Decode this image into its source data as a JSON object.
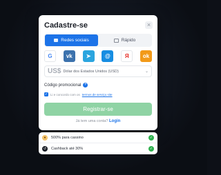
{
  "modal": {
    "title": "Cadastre-se",
    "close_glyph": "×"
  },
  "tabs": [
    {
      "label": "Redes sociais",
      "active": true,
      "icon": "chat-icon"
    },
    {
      "label": "Rápido",
      "active": false,
      "icon": "grid-icon"
    }
  ],
  "socials": [
    {
      "name": "google",
      "glyph": "G"
    },
    {
      "name": "vk",
      "glyph": "vk"
    },
    {
      "name": "telegram",
      "glyph": "➤"
    },
    {
      "name": "mail",
      "glyph": "@"
    },
    {
      "name": "yandex",
      "glyph": "Я"
    },
    {
      "name": "ok",
      "glyph": "ok"
    }
  ],
  "currency": {
    "code": "US$",
    "name": "Dólar dos Estados Unidos (USD)",
    "chevron": "⌄"
  },
  "promo": {
    "label": "Código promocional",
    "plus": "+"
  },
  "agree": {
    "prefix": "Li e concordo com os",
    "link": "termos de serviço site",
    "check": "✓"
  },
  "register_label": "Registrar-se",
  "login": {
    "prefix": "Já tem uma conta?",
    "link": "Login"
  },
  "bonuses": [
    {
      "label": "500% para cassino",
      "icon": "casino-icon",
      "glyph": "♦",
      "ok": "✓"
    },
    {
      "label": "Cashback até 30%",
      "icon": "cashback-icon",
      "glyph": "↺",
      "ok": "✓"
    }
  ],
  "colors": {
    "accent": "#1c73e8",
    "register": "#8fd3a4",
    "success": "#2fb04e"
  }
}
